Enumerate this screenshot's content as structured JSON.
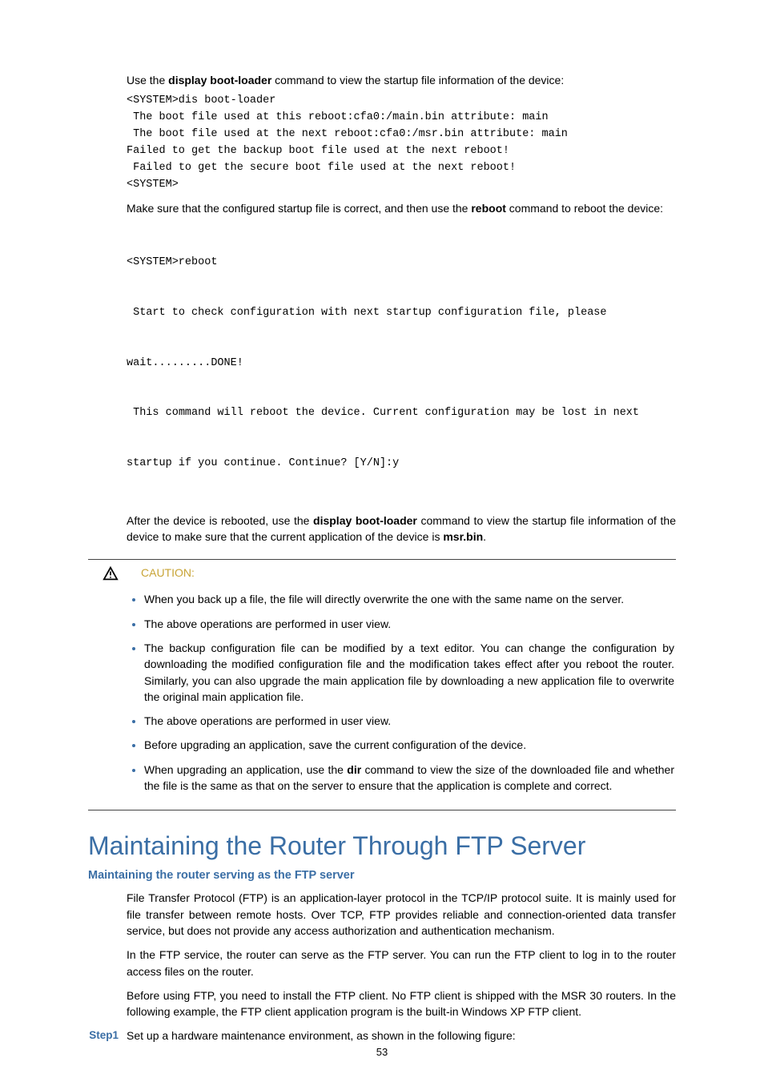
{
  "intro1_a": "Use the ",
  "intro1_b": "display boot-loader",
  "intro1_c": " command to view the startup file information of the device:",
  "code1": "<SYSTEM>dis boot-loader\n The boot file used at this reboot:cfa0:/main.bin attribute: main\n The boot file used at the next reboot:cfa0:/msr.bin attribute: main\nFailed to get the backup boot file used at the next reboot!\n Failed to get the secure boot file used at the next reboot!\n<SYSTEM>",
  "intro2_a": "Make sure that the configured startup file is correct, and then use the ",
  "intro2_b": "reboot",
  "intro2_c": " command to reboot the device:",
  "code2_l1": "<SYSTEM>reboot",
  "code2_l2": " Start to check configuration with next startup configuration file, please",
  "code2_l3": "wait.........DONE!",
  "code2_l4": " This command will reboot the device. Current configuration may be lost in next",
  "code2_l5": "startup if you continue. Continue? [Y/N]:y",
  "intro3_a": "After the device is rebooted, use the ",
  "intro3_b": "display boot-loader",
  "intro3_c": " command to view the startup file information of the device to make sure that the current application of the device is ",
  "intro3_d": "msr.bin",
  "intro3_e": ".",
  "caution_label": "CAUTION:",
  "bullets": {
    "b1": "When you back up a file, the file will directly overwrite the one with the same name on the server.",
    "b2": "The above operations are performed in user view.",
    "b3": "The backup configuration file can be modified by a text editor. You can change the configuration by downloading the modified configuration file and the modification takes effect after you reboot the router. Similarly, you can also upgrade the main application file by downloading a new application file to overwrite the original main application file.",
    "b4": "The above operations are performed in user view.",
    "b5": "Before upgrading an application, save the current configuration of the device.",
    "b6_a": "When upgrading an application, use the ",
    "b6_b": "dir",
    "b6_c": " command to view the size of the downloaded file and whether the file is the same as that on the server to ensure that the application is complete and correct."
  },
  "h1": "Maintaining the Router Through FTP Server",
  "h2": "Maintaining the router serving as the FTP server",
  "p1": "File Transfer Protocol (FTP) is an application-layer protocol in the TCP/IP protocol suite. It is mainly used for file transfer between remote hosts. Over TCP, FTP provides reliable and connection-oriented data transfer service, but does not provide any access authorization and authentication mechanism.",
  "p2": "In the FTP service, the router can serve as the FTP server. You can run the FTP client to log in to the router access files on the router.",
  "p3": "Before using FTP, you need to install the FTP client. No FTP client is shipped with the MSR 30 routers. In the following example, the FTP client application program is the built-in Windows XP FTP client.",
  "step1_label": "Step1",
  "step1_text": "Set up a hardware maintenance environment, as shown in the following figure:",
  "page_number": "53"
}
